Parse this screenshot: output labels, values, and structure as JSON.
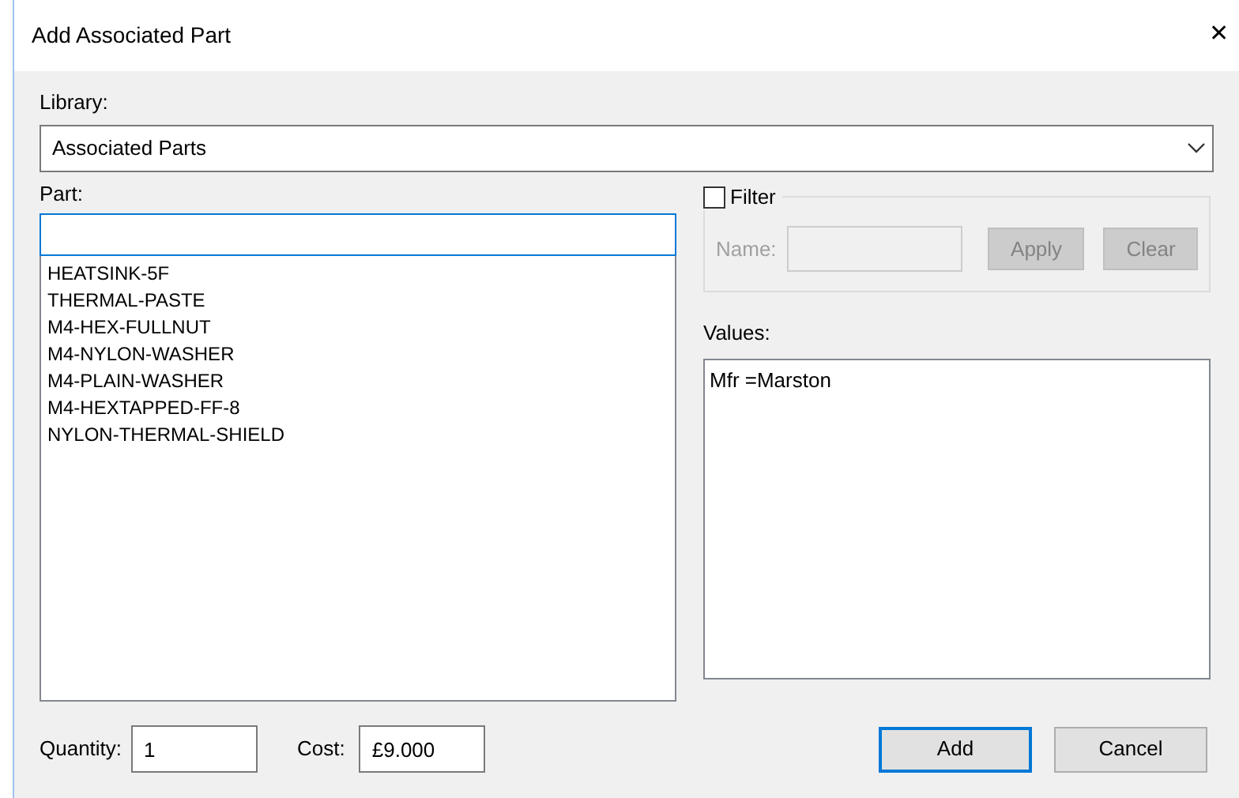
{
  "window": {
    "title": "Add Associated Part",
    "close": "✕"
  },
  "library": {
    "label": "Library:",
    "value": "Associated Parts"
  },
  "part": {
    "label": "Part:",
    "focused": true,
    "items": [
      "HEATSINK-5F",
      "THERMAL-PASTE",
      "M4-HEX-FULLNUT",
      "M4-NYLON-WASHER",
      "M4-PLAIN-WASHER",
      "M4-HEXTAPPED-FF-8",
      "NYLON-THERMAL-SHIELD"
    ]
  },
  "filter": {
    "label": "Filter",
    "checked": false,
    "disabled": true,
    "name_label": "Name:",
    "buttons": [
      "Apply",
      "Clear"
    ]
  },
  "values": {
    "label": "Values:",
    "lines": [
      "Mfr =Marston"
    ]
  },
  "quantity": {
    "label": "Quantity:",
    "value": "1"
  },
  "cost": {
    "label": "Cost:",
    "value": "£9.000"
  },
  "buttons": [
    {
      "label": "Add",
      "default": true
    },
    {
      "label": "Cancel",
      "default": false
    }
  ]
}
